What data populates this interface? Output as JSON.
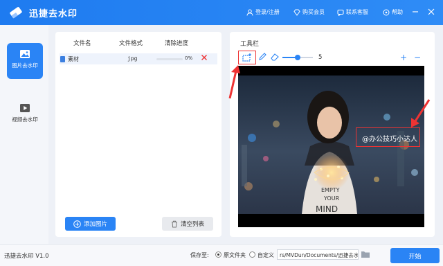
{
  "header": {
    "title": "迅捷去水印",
    "login": "登录/注册",
    "buy": "购买会员",
    "contact": "联系客服",
    "help": "帮助"
  },
  "sidebar": {
    "items": [
      {
        "label": "图片去水印",
        "icon": "image-icon",
        "active": true
      },
      {
        "label": "视频去水印",
        "icon": "video-play-icon",
        "active": false
      }
    ]
  },
  "file_list": {
    "columns": [
      "文件名",
      "文件格式",
      "清除进度"
    ],
    "rows": [
      {
        "name": "素材",
        "format": "jpg",
        "progress_percent": 0,
        "progress_text": "0%"
      }
    ],
    "add_button": "添加图片",
    "clear_button": "清空列表"
  },
  "toolbar": {
    "title": "工具栏",
    "brush_size": "5",
    "brush_slider_fraction": 0.5,
    "zoom_in": "+",
    "zoom_out": "−"
  },
  "canvas": {
    "watermark_text": "@办公技巧小达人",
    "shirt_text_1": "EMPTY",
    "shirt_text_2": "YOUR",
    "shirt_text_3": "MIND"
  },
  "footer": {
    "version": "迅捷去水印 V1.0",
    "save_to": "保存至:",
    "option_original": "原文件夹",
    "option_custom": "自定义",
    "path": "rs/MVDun/Documents/迅捷去水印",
    "start": "开始"
  },
  "colors": {
    "accent": "#2a84f5",
    "highlight": "#e33333"
  }
}
